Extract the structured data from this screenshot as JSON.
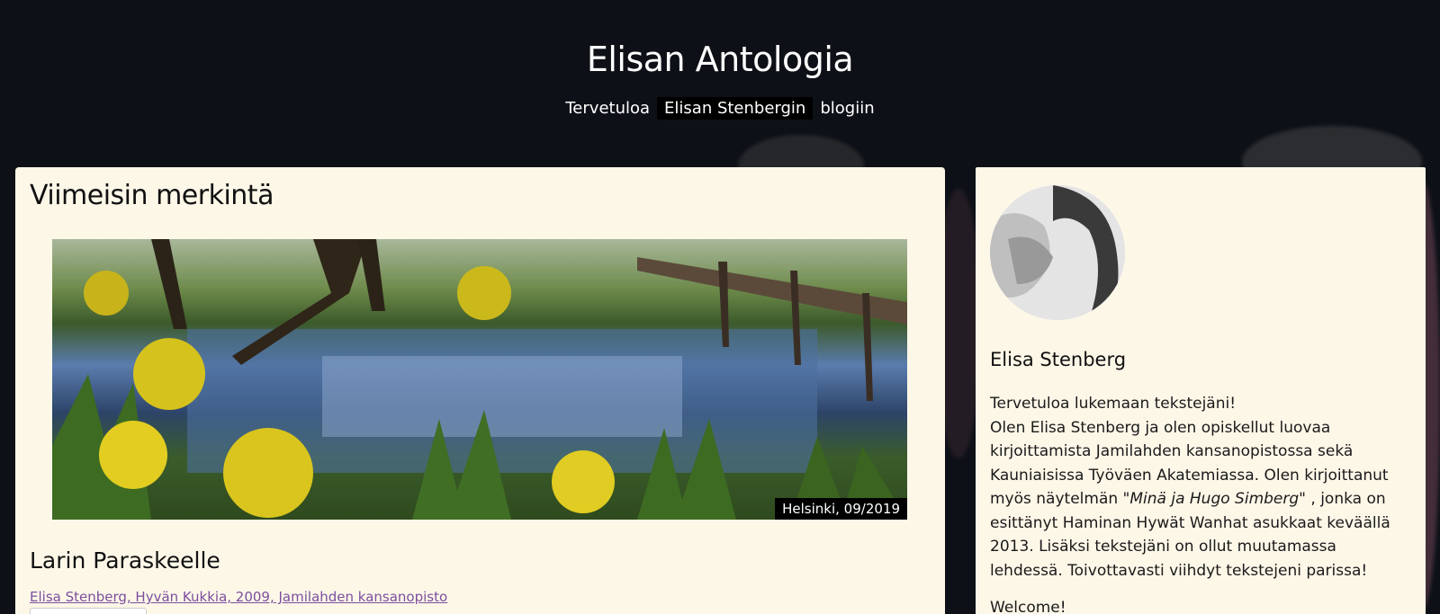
{
  "header": {
    "title": "Elisan Antologia",
    "tagline_before": "Tervetuloa",
    "tagline_highlight": "Elisan Stenbergin",
    "tagline_after": "blogiin"
  },
  "main": {
    "heading": "Viimeisin merkintä",
    "photo_caption": "Helsinki, 09/2019",
    "post_title": "Larin Paraskeelle",
    "post_meta": "Elisa Stenberg, Hyvän Kukkia, 2009, Jamilahden kansanopisto"
  },
  "sidebar": {
    "name": "Elisa Stenberg",
    "intro_line": "Tervetuloa lukemaan tekstejäni!",
    "bio_part1": "Olen Elisa Stenberg ja olen opiskellut luovaa kirjoittamista Jamilahden kansanopistossa sekä Kauniaisissa Työväen Akatemiassa. Olen kirjoittanut myös näytelmän ",
    "bio_play": "\"Minä ja Hugo Simberg\"",
    "bio_part2": " , jonka on esittänyt Haminan Hywät Wanhat asukkaat keväällä 2013. Lisäksi tekstejäni on ollut muutamassa lehdessä. Toivottavasti viihdyt tekstejeni parissa!",
    "welcome": "Welcome!"
  },
  "colors": {
    "background": "#0d1117",
    "card": "#fdf7e8",
    "link": "#7b4f9e"
  }
}
